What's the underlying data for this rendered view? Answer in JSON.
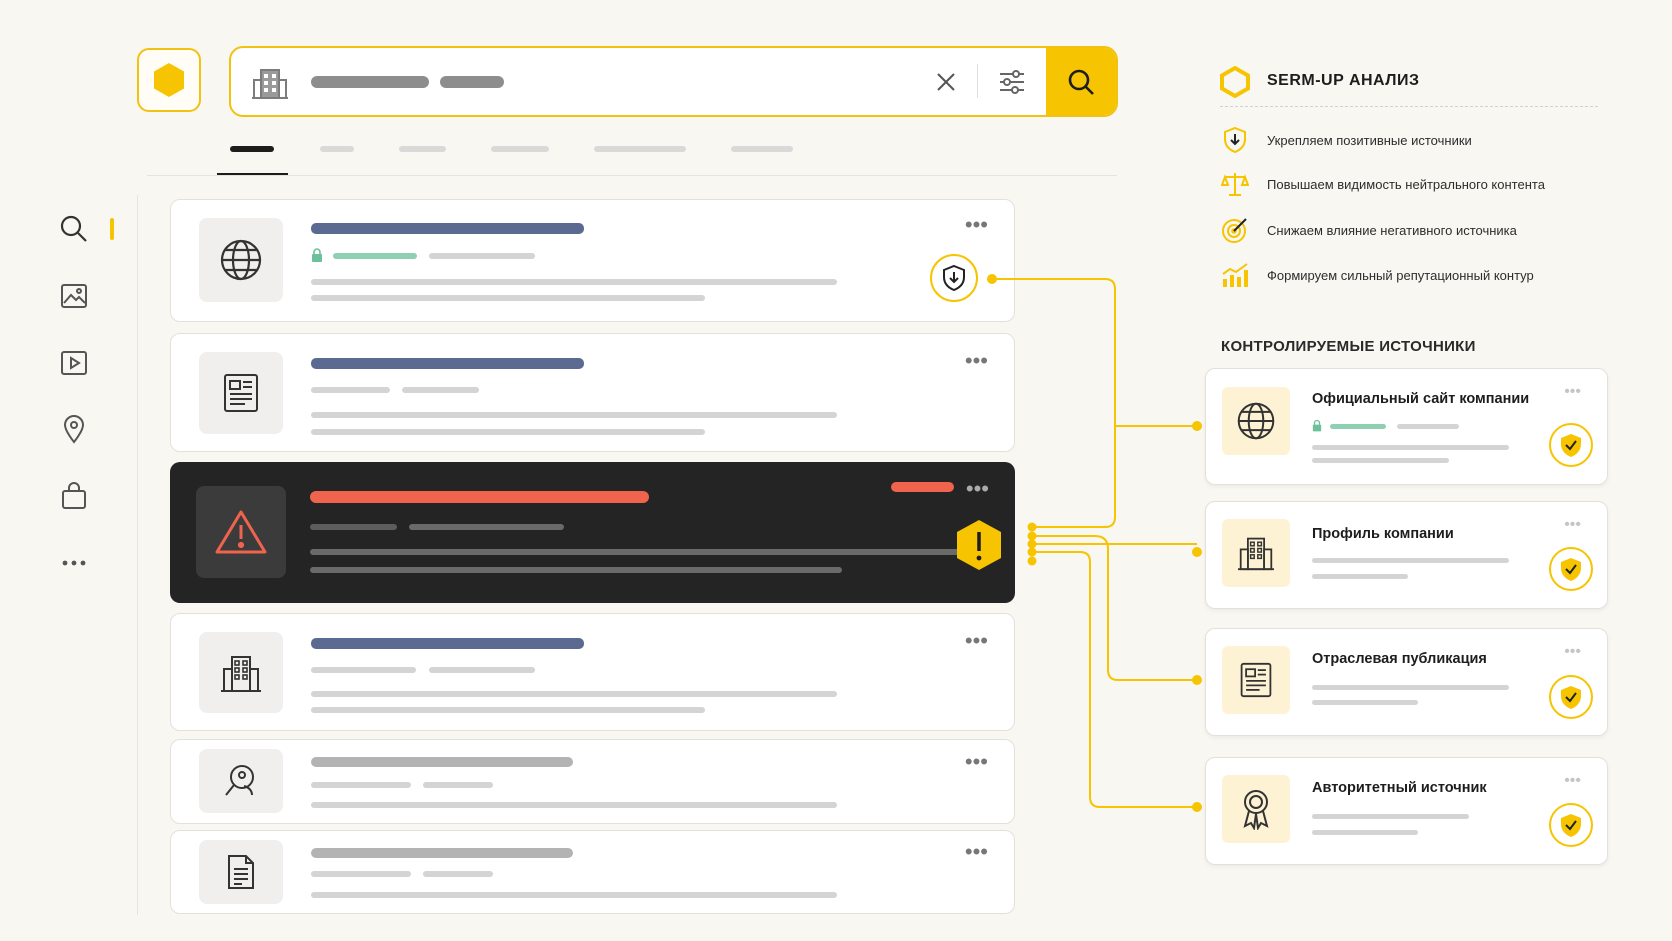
{
  "panel": {
    "title": "SERM-UP АНАЛИЗ",
    "features": [
      {
        "icon": "shield-arrow-icon",
        "text": "Укрепляем позитивные источники"
      },
      {
        "icon": "scales-icon",
        "text": "Повышаем видимость нейтрального контента"
      },
      {
        "icon": "target-icon",
        "text": "Снижаем влияние негативного источника"
      },
      {
        "icon": "growth-chart-icon",
        "text": "Формируем сильный репутационный контур"
      }
    ],
    "sources_title": "КОНТРОЛИРУЕМЫЕ ИСТОЧНИКИ",
    "sources": [
      {
        "icon": "globe-icon",
        "name": "Официальный сайт компании"
      },
      {
        "icon": "building-icon",
        "name": "Профиль компании"
      },
      {
        "icon": "newspaper-icon",
        "name": "Отраслевая публикация"
      },
      {
        "icon": "award-ribbon-icon",
        "name": "Авторитетный источник"
      }
    ]
  },
  "search": {
    "icon": "building-icon",
    "actions": [
      "close-icon",
      "filter-sliders-icon",
      "search-icon"
    ]
  },
  "sidebar": {
    "icons": [
      "search-icon",
      "image-icon",
      "video-play-icon",
      "map-pin-icon",
      "shopping-bag-icon",
      "more-dots-icon"
    ]
  },
  "results": [
    {
      "icon": "globe-icon",
      "status": "protected"
    },
    {
      "icon": "newspaper-icon",
      "status": "neutral"
    },
    {
      "icon": "warning-triangle-icon",
      "status": "negative"
    },
    {
      "icon": "building-icon",
      "status": "neutral"
    },
    {
      "icon": "magnifier-person-icon",
      "status": "neutral"
    },
    {
      "icon": "document-icon",
      "status": "neutral"
    }
  ],
  "colors": {
    "accent": "#f6c400",
    "negative": "#f0634c",
    "title_bar": "#5a6a91",
    "secure": "#8fd0b2",
    "dark_card": "#242424"
  }
}
